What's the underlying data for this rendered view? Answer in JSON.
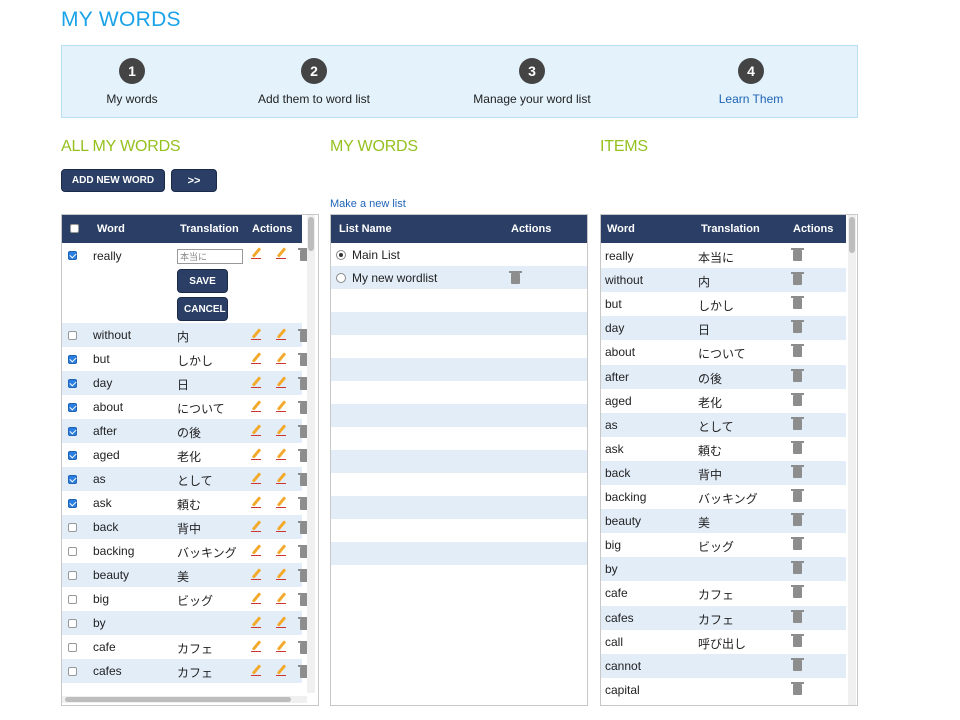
{
  "page_title": "MY WORDS",
  "steps": [
    {
      "num": "1",
      "label": "My words",
      "link": false
    },
    {
      "num": "2",
      "label": "Add them to word list",
      "link": false
    },
    {
      "num": "3",
      "label": "Manage your word list",
      "link": false
    },
    {
      "num": "4",
      "label": "Learn Them",
      "link": true
    }
  ],
  "sections": {
    "all_words": "ALL MY WORDS",
    "my_words": "MY WORDS",
    "items": "ITEMS"
  },
  "buttons": {
    "add_new_word": "ADD NEW WORD",
    "forward": ">>",
    "save": "SAVE",
    "cancel": "CANCEL"
  },
  "make_new_list": "Make a new list",
  "all_words_table": {
    "headers": [
      "Word",
      "Translation",
      "Actions"
    ],
    "editing_row": {
      "word": "really",
      "input_value": "本当に",
      "checked": true
    },
    "rows": [
      {
        "word": "without",
        "translation": "内",
        "checked": false
      },
      {
        "word": "but",
        "translation": "しかし",
        "checked": true
      },
      {
        "word": "day",
        "translation": "日",
        "checked": true
      },
      {
        "word": "about",
        "translation": "について",
        "checked": true
      },
      {
        "word": "after",
        "translation": "の後",
        "checked": true
      },
      {
        "word": "aged",
        "translation": "老化",
        "checked": true
      },
      {
        "word": "as",
        "translation": "として",
        "checked": true
      },
      {
        "word": "ask",
        "translation": "頼む",
        "checked": true
      },
      {
        "word": "back",
        "translation": "背中",
        "checked": false
      },
      {
        "word": "backing",
        "translation": "バッキング",
        "checked": false
      },
      {
        "word": "beauty",
        "translation": "美",
        "checked": false
      },
      {
        "word": "big",
        "translation": "ビッグ",
        "checked": false
      },
      {
        "word": "by",
        "translation": "",
        "checked": false
      },
      {
        "word": "cafe",
        "translation": "カフェ",
        "checked": false
      },
      {
        "word": "cafes",
        "translation": "カフェ",
        "checked": false
      }
    ]
  },
  "lists_table": {
    "headers": [
      "List Name",
      "Actions"
    ],
    "rows": [
      {
        "name": "Main List",
        "selected": true,
        "deletable": false
      },
      {
        "name": "My new wordlist",
        "selected": false,
        "deletable": true
      }
    ]
  },
  "items_table": {
    "headers": [
      "Word",
      "Translation",
      "Actions"
    ],
    "rows": [
      {
        "word": "really",
        "translation": "本当に"
      },
      {
        "word": "without",
        "translation": "内"
      },
      {
        "word": "but",
        "translation": "しかし"
      },
      {
        "word": "day",
        "translation": "日"
      },
      {
        "word": "about",
        "translation": "について"
      },
      {
        "word": "after",
        "translation": "の後"
      },
      {
        "word": "aged",
        "translation": "老化"
      },
      {
        "word": "as",
        "translation": "として"
      },
      {
        "word": "ask",
        "translation": "頼む"
      },
      {
        "word": "back",
        "translation": "背中"
      },
      {
        "word": "backing",
        "translation": "バッキング"
      },
      {
        "word": "beauty",
        "translation": "美"
      },
      {
        "word": "big",
        "translation": "ビッグ"
      },
      {
        "word": "by",
        "translation": ""
      },
      {
        "word": "cafe",
        "translation": "カフェ"
      },
      {
        "word": "cafes",
        "translation": "カフェ"
      },
      {
        "word": "call",
        "translation": "呼び出し"
      },
      {
        "word": "cannot",
        "translation": ""
      },
      {
        "word": "capital",
        "translation": ""
      }
    ]
  },
  "colors": {
    "title_blue": "#1aa3e8",
    "section_green": "#95c11f",
    "header_navy": "#2b3f66",
    "row_alt": "#e3edf8",
    "step_bg": "#e3f2fb"
  },
  "icons": {
    "edit": "pencil-icon",
    "delete": "trash-icon"
  }
}
